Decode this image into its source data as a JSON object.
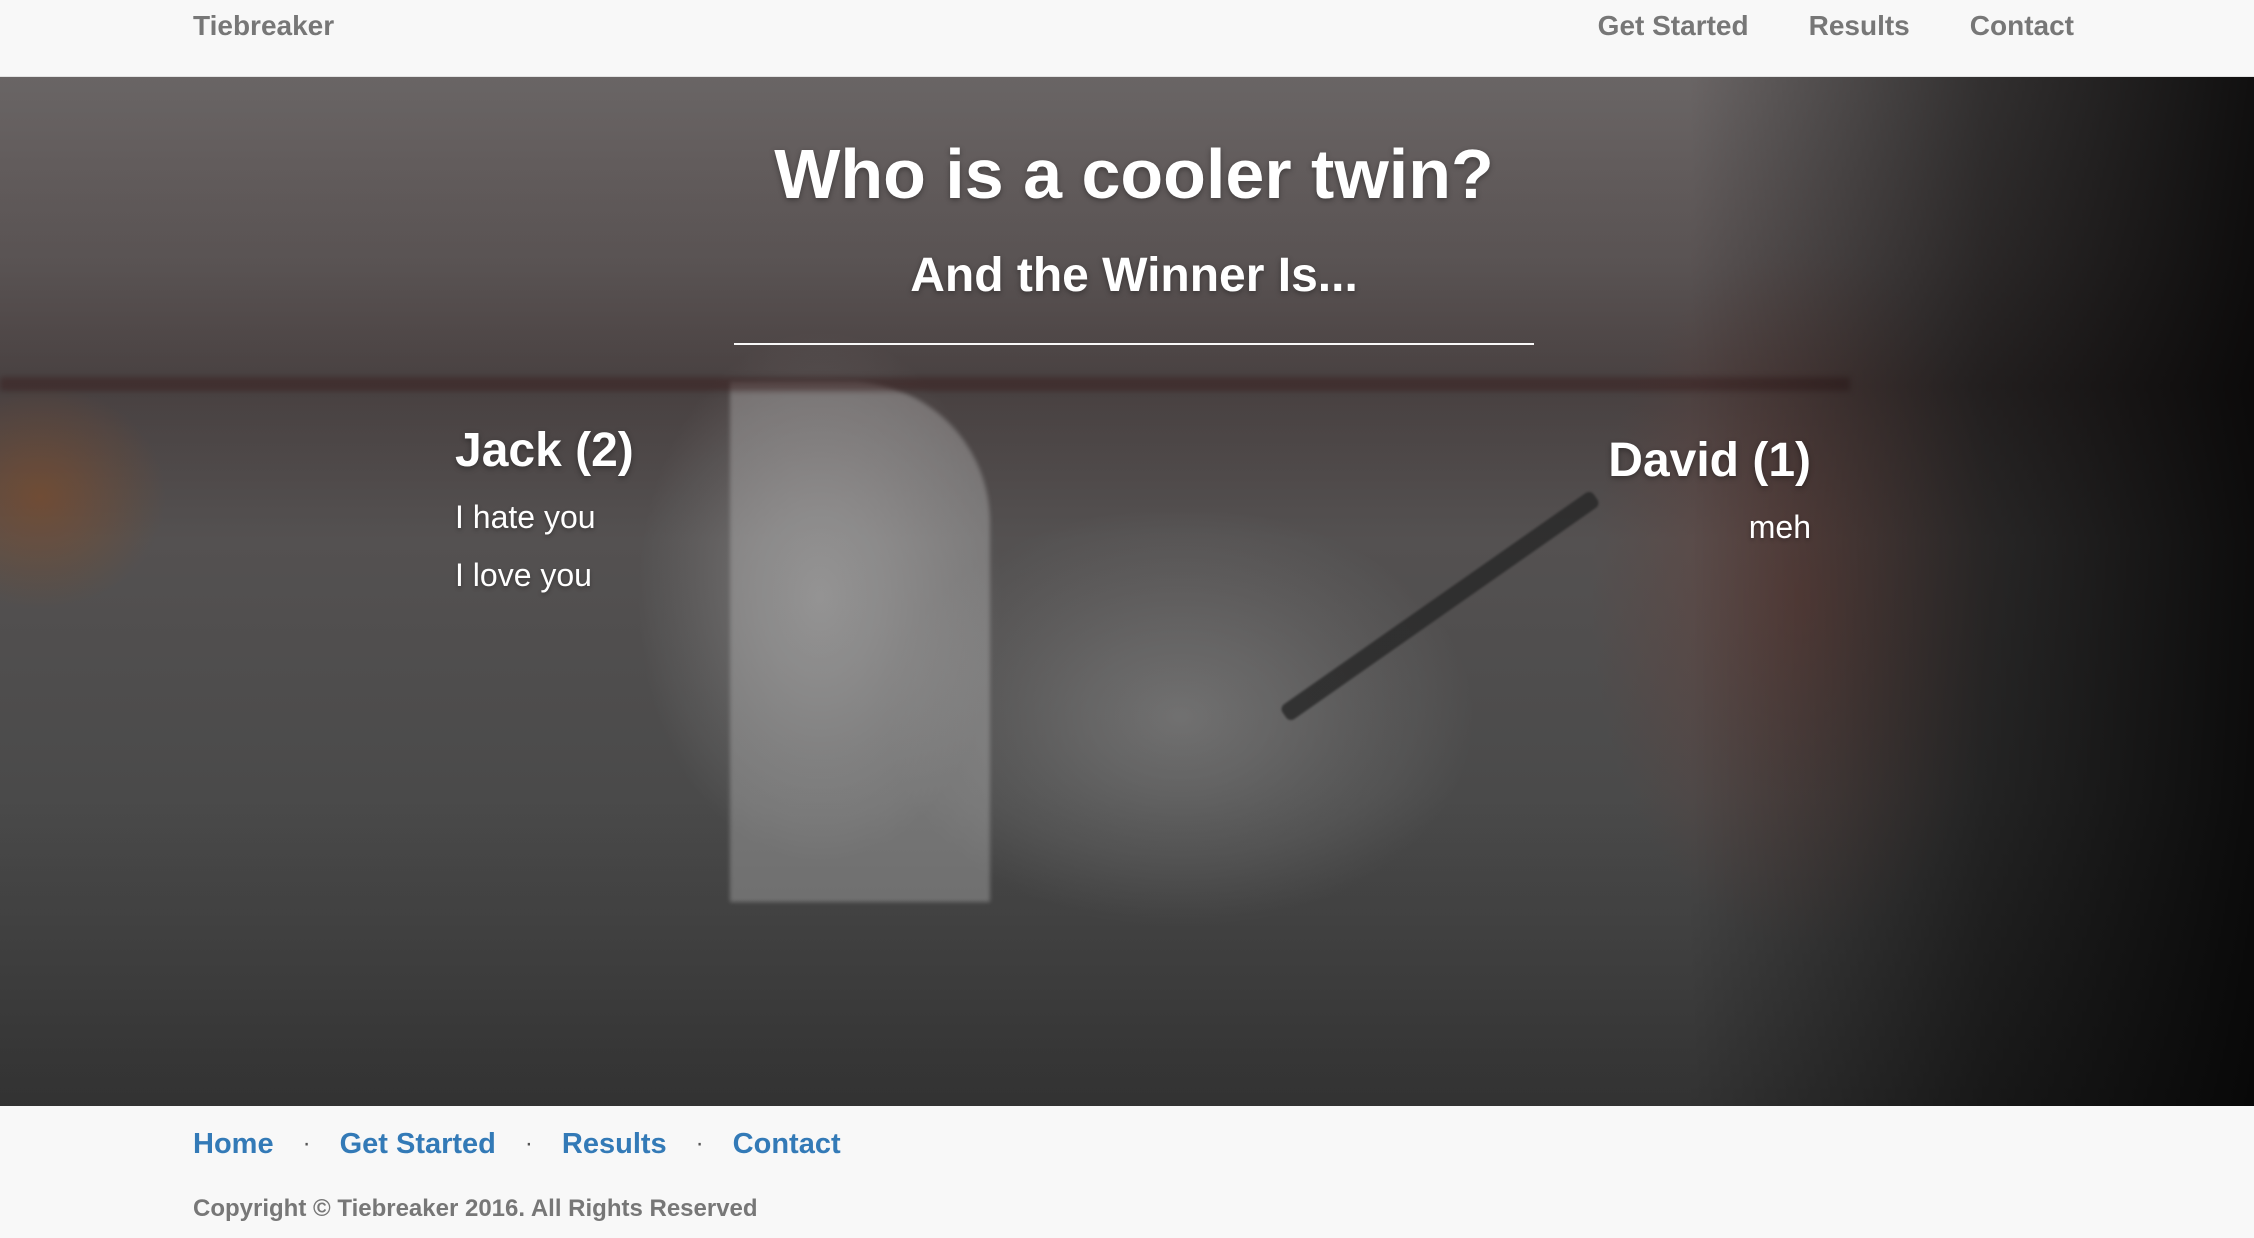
{
  "navbar": {
    "brand": "Tiebreaker",
    "links": [
      "Get Started",
      "Results",
      "Contact"
    ]
  },
  "hero": {
    "title": "Who is a cooler twin?",
    "subtitle": "And the Winner Is...",
    "candidates": [
      {
        "name": "Jack (2)",
        "reasons": [
          "I hate you",
          "I love you"
        ]
      },
      {
        "name": "David (1)",
        "reasons": [
          "meh"
        ]
      }
    ]
  },
  "footer": {
    "links": [
      "Home",
      "Get Started",
      "Results",
      "Contact"
    ],
    "separator": "·",
    "copyright": "Copyright © Tiebreaker 2016. All Rights Reserved"
  },
  "colors": {
    "link": "#337ab7",
    "nav_text": "#777777",
    "background": "#f8f8f8",
    "hero_text": "#ffffff"
  }
}
